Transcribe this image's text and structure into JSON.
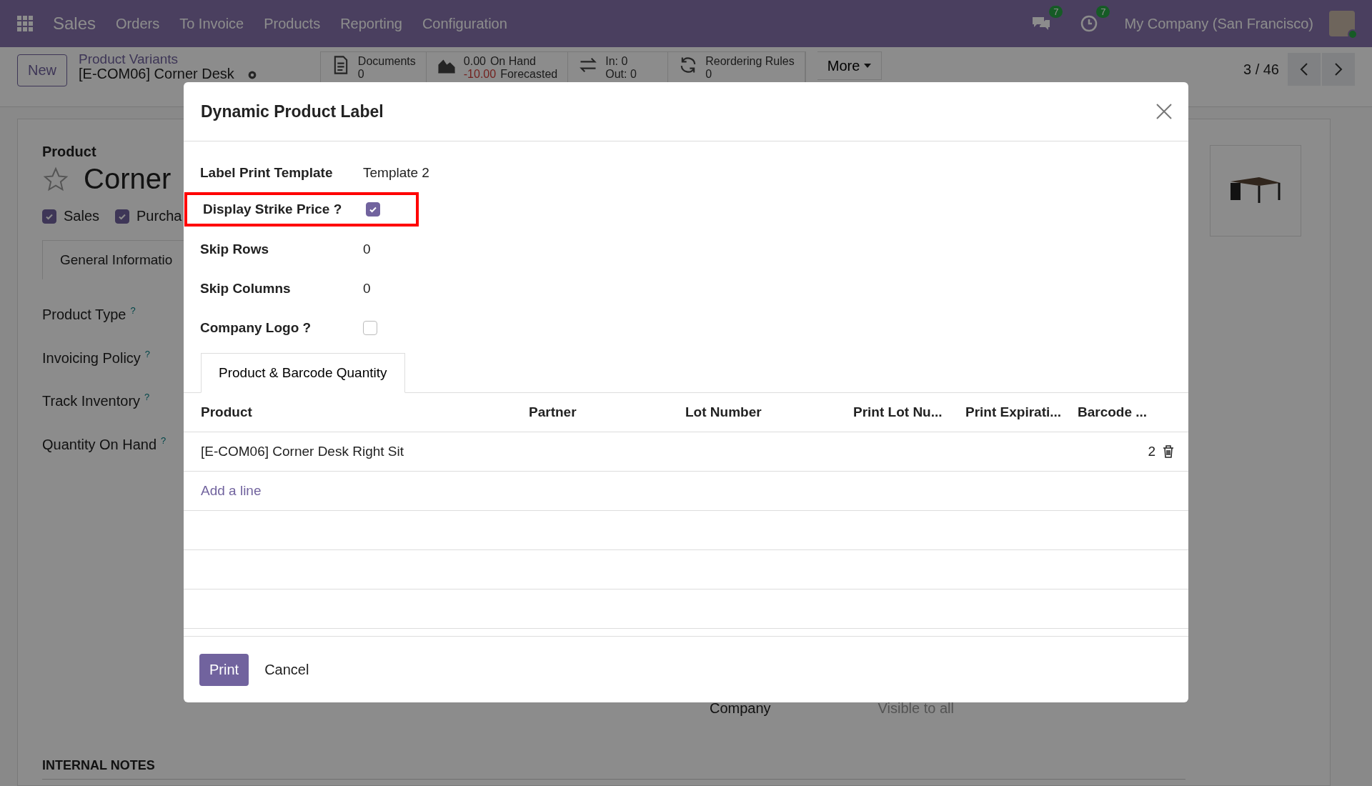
{
  "navbar": {
    "app_name": "Sales",
    "menu": [
      "Orders",
      "To Invoice",
      "Products",
      "Reporting",
      "Configuration"
    ],
    "messages_count": "7",
    "activities_count": "7",
    "company": "My Company (San Francisco)"
  },
  "control_panel": {
    "new_button": "New",
    "breadcrumb": "Product Variants",
    "record": "[E-COM06] Corner Desk",
    "stat_buttons": [
      {
        "kind": "documents",
        "title": "Documents",
        "detail": "0"
      },
      {
        "kind": "forecast",
        "value": "0.00",
        "title": "On Hand",
        "detail_value": "-10.00",
        "detail": "Forecasted"
      },
      {
        "kind": "moves",
        "title": "In: 0",
        "detail": "Out: 0"
      },
      {
        "kind": "reordering",
        "title": "Reordering Rules",
        "detail": "0"
      }
    ],
    "more_button": "More",
    "pager": "3 / 46"
  },
  "form": {
    "label": "Product",
    "name": "Corner",
    "flags": [
      {
        "label": "Sales",
        "checked": true
      },
      {
        "label": "Purcha",
        "checked": true
      }
    ],
    "tab": "General Informatio",
    "fields": [
      {
        "label": "Product Type",
        "help": "?"
      },
      {
        "label": "Invoicing Policy",
        "help": "?"
      },
      {
        "label": "Track Inventory",
        "help": "?"
      },
      {
        "label": "Quantity On Hand",
        "help": "?"
      }
    ],
    "company_label": "Company",
    "company_value": "Visible to all",
    "notes_heading": "INTERNAL NOTES"
  },
  "dialog": {
    "title": "Dynamic Product Label",
    "fields": [
      {
        "kind": "text",
        "label": "Label Print Template",
        "value": "Template 2",
        "highlighted": false
      },
      {
        "kind": "checkbox",
        "label": "Display Strike Price ?",
        "checked": true,
        "highlighted": true
      },
      {
        "kind": "text",
        "label": "Skip Rows",
        "value": "0",
        "highlighted": false
      },
      {
        "kind": "text",
        "label": "Skip Columns",
        "value": "0",
        "highlighted": false
      },
      {
        "kind": "checkbox",
        "label": "Company Logo ?",
        "checked": false,
        "highlighted": false
      }
    ],
    "tab": "Product & Barcode Quantity",
    "table": {
      "columns": [
        "Product",
        "Partner",
        "Lot Number",
        "Print Lot Nu...",
        "Print Expirati...",
        "Barcode ..."
      ],
      "rows": [
        {
          "product": "[E-COM06] Corner Desk Right Sit",
          "barcode_qty": "2"
        }
      ],
      "add_line": "Add a line"
    },
    "buttons": [
      {
        "kind": "primary",
        "label": "Print"
      },
      {
        "kind": "secondary",
        "label": "Cancel"
      }
    ]
  }
}
